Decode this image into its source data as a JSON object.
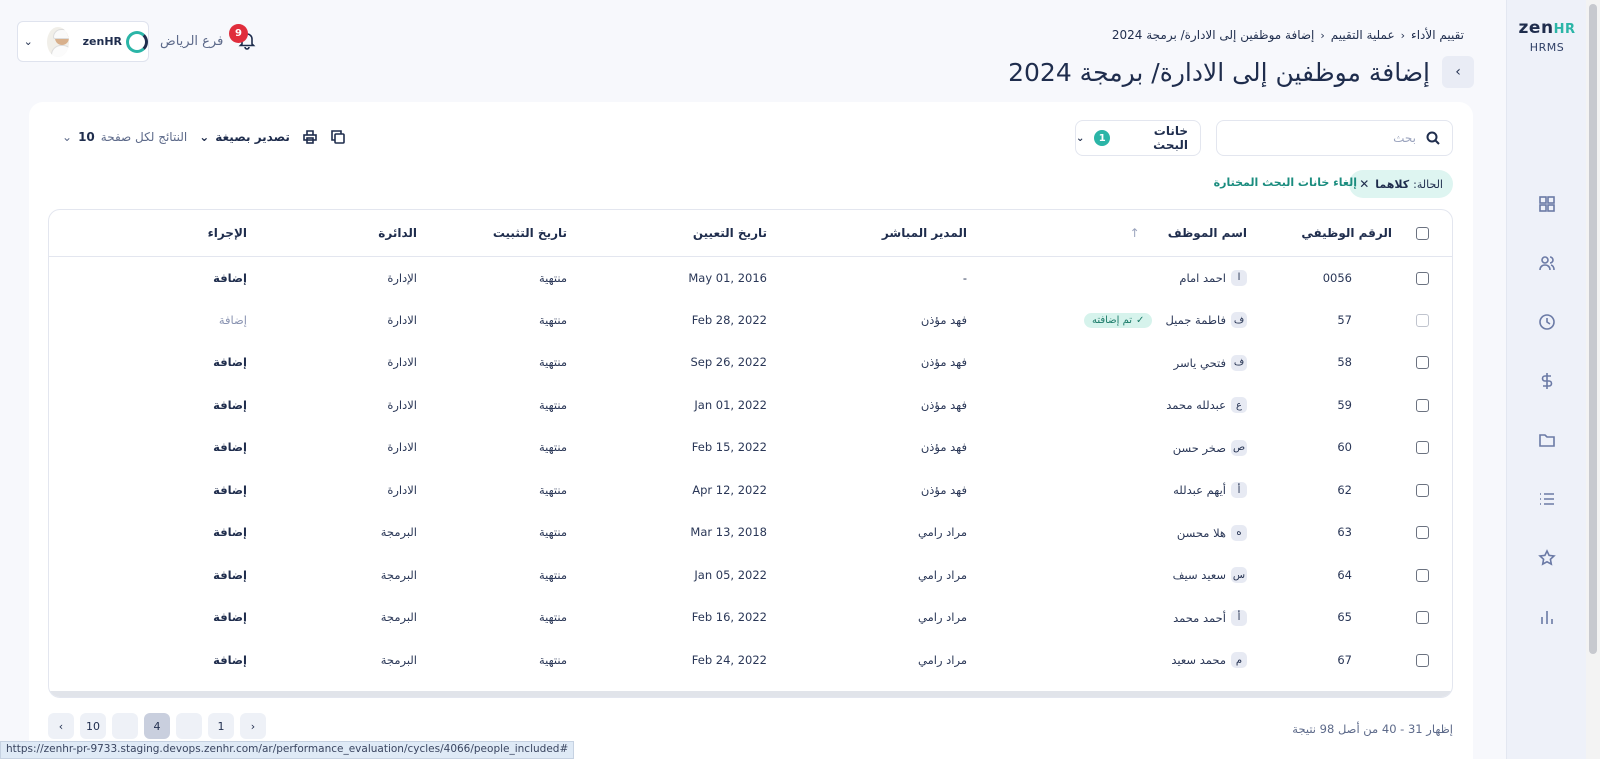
{
  "brand": {
    "logo_main": "zen",
    "logo_accent": "HR",
    "subtitle": "HRMS"
  },
  "breadcrumb": [
    "تقييم الأداء",
    "عملية التقييم",
    "إضافة موظفين إلى الادارة/ برمجة 2024"
  ],
  "page_title": "إضافة موظفين إلى الادارة/ برمجة 2024",
  "header": {
    "notification_count": "9",
    "branch": "فرع الرياض",
    "mini_logo": "zenHR"
  },
  "sidebar_icons": [
    "dashboard-icon",
    "users-icon",
    "clock-icon",
    "dollar-icon",
    "folder-icon",
    "list-icon",
    "star-icon",
    "chart-icon"
  ],
  "search": {
    "placeholder": "بحث"
  },
  "filters": {
    "label": "خانات البحث",
    "count": "1"
  },
  "toolbar": {
    "export_label": "تصدير بصيغة",
    "per_page_label": "النتائج لكل صفحة",
    "per_page_value": "10"
  },
  "chip": {
    "label": "الحالة:",
    "value": "كلاهما"
  },
  "clear_filters": "إلغاء خانات البحث المختارة",
  "table": {
    "headers": [
      "الرقم الوظيفي",
      "اسم الموظف",
      "المدير المباشر",
      "تاريخ التعيين",
      "تاريخ التثبيت",
      "الدائرة",
      "الإجراء"
    ],
    "added_badge": "تم إضافته",
    "rows": [
      {
        "id": "0056",
        "initial": "ا",
        "name": "احمد امام",
        "manager": "-",
        "hire_date": "May 01, 2016",
        "confirm": "منتهية",
        "dept": "الإدارة",
        "action": "إضافة",
        "added": false
      },
      {
        "id": "57",
        "initial": "ف",
        "name": "فاطمة جميل",
        "manager": "فهد مؤذن",
        "hire_date": "Feb 28, 2022",
        "confirm": "منتهية",
        "dept": "الادارة",
        "action": "إضافة",
        "added": true
      },
      {
        "id": "58",
        "initial": "ف",
        "name": "فتحي ياسر",
        "manager": "فهد مؤذن",
        "hire_date": "Sep 26, 2022",
        "confirm": "منتهية",
        "dept": "الادارة",
        "action": "إضافة",
        "added": false
      },
      {
        "id": "59",
        "initial": "ع",
        "name": "عبدلله محمد",
        "manager": "فهد مؤذن",
        "hire_date": "Jan 01, 2022",
        "confirm": "منتهية",
        "dept": "الادارة",
        "action": "إضافة",
        "added": false
      },
      {
        "id": "60",
        "initial": "ص",
        "name": "صخر حسن",
        "manager": "فهد مؤذن",
        "hire_date": "Feb 15, 2022",
        "confirm": "منتهية",
        "dept": "الادارة",
        "action": "إضافة",
        "added": false
      },
      {
        "id": "62",
        "initial": "أ",
        "name": "أيهم عبدلله",
        "manager": "فهد مؤذن",
        "hire_date": "Apr 12, 2022",
        "confirm": "منتهية",
        "dept": "الادارة",
        "action": "إضافة",
        "added": false
      },
      {
        "id": "63",
        "initial": "ه",
        "name": "هلا محسن",
        "manager": "مراد رامي",
        "hire_date": "Mar 13, 2018",
        "confirm": "منتهية",
        "dept": "البرمجة",
        "action": "إضافة",
        "added": false
      },
      {
        "id": "64",
        "initial": "س",
        "name": "سعيد سيف",
        "manager": "مراد رامي",
        "hire_date": "Jan 05, 2022",
        "confirm": "منتهية",
        "dept": "البرمجة",
        "action": "إضافة",
        "added": false
      },
      {
        "id": "65",
        "initial": "أ",
        "name": "أحمد محمد",
        "manager": "مراد رامي",
        "hire_date": "Feb 16, 2022",
        "confirm": "منتهية",
        "dept": "البرمجة",
        "action": "إضافة",
        "added": false
      },
      {
        "id": "67",
        "initial": "م",
        "name": "محمد سعيد",
        "manager": "مراد رامي",
        "hire_date": "Feb 24, 2022",
        "confirm": "منتهية",
        "dept": "البرمجة",
        "action": "إضافة",
        "added": false
      }
    ]
  },
  "pagination": {
    "pages": [
      "10",
      "",
      "4",
      "",
      "1"
    ],
    "active": "4"
  },
  "result_count": "إظهار 31 - 40 من أصل 98 نتيجة",
  "status_url": "https://zenhr-pr-9733.staging.devops.zenhr.com/ar/performance_evaluation/cycles/4066/people_included#",
  "colors": {
    "accent": "#2bb5a7",
    "primary": "#1f2d4d",
    "badge": "#e02d3c"
  }
}
